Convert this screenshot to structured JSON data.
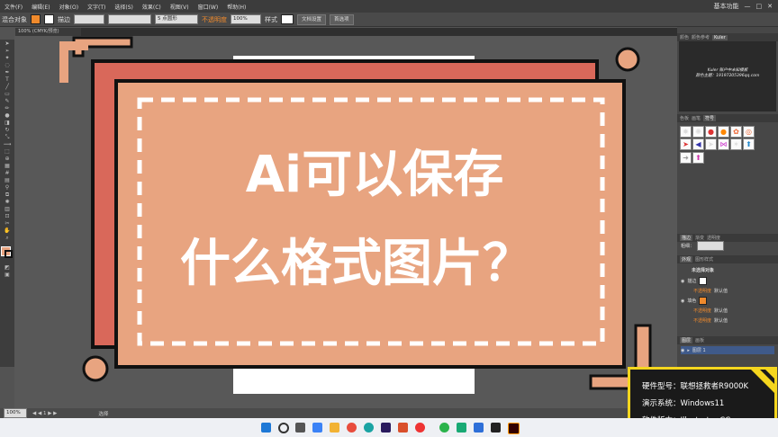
{
  "menu": {
    "items": [
      "文件(F)",
      "编辑(E)",
      "对象(O)",
      "文字(T)",
      "选择(S)",
      "效果(C)",
      "视图(V)",
      "窗口(W)",
      "帮助(H)"
    ],
    "workspace": "基本功能",
    "window_controls": [
      "—",
      "□",
      "✕"
    ]
  },
  "control_bar": {
    "selection_label": "混合对象",
    "stroke_label": "描边",
    "stroke_value": "5 点圆形",
    "opacity_label": "不透明度",
    "opacity_value": "100%",
    "style_label": "样式",
    "doc_setup_button": "文档设置",
    "preferences_button": "首选项"
  },
  "document": {
    "tab_label": "100% (CMYK/预览)",
    "zoom": "100%",
    "status_tool": "选择"
  },
  "overlay": {
    "headline_line1": "Ai可以保存",
    "headline_line2": "什么格式图片？"
  },
  "right_panel": {
    "color_tabs": [
      "颜色",
      "颜色参考",
      "Kuler"
    ],
    "kuler_line1": "Kuler 账户中未知模板",
    "kuler_line2": "颜色主题：19197205396qq.com",
    "symbol_tabs": [
      "色板",
      "画笔",
      "符号"
    ],
    "stroke_tabs": [
      "描边",
      "渐变",
      "透明度"
    ],
    "stroke_weight_label": "粗细：",
    "appearance_tabs": [
      "外观",
      "图形样式"
    ],
    "appearance_title": "未选择对象",
    "appearance_rows": [
      {
        "label": "描边"
      },
      {
        "label": "不透明度",
        "value": "默认值"
      },
      {
        "label": "填色"
      },
      {
        "label": "不透明度",
        "value": "默认值"
      },
      {
        "label": "不透明度",
        "value": "默认值"
      }
    ],
    "layers_tabs": [
      "图层",
      "画板"
    ],
    "layer_name": "图层 1"
  },
  "info_box": {
    "model": "硬件型号：联想拯救者R9000K",
    "system": "演示系统：Windows11",
    "software": "软件版本：Illustrator CC"
  },
  "colors": {
    "accent_salmon": "#e8a480",
    "accent_red": "#d9685a",
    "info_border": "#f5d61e"
  }
}
